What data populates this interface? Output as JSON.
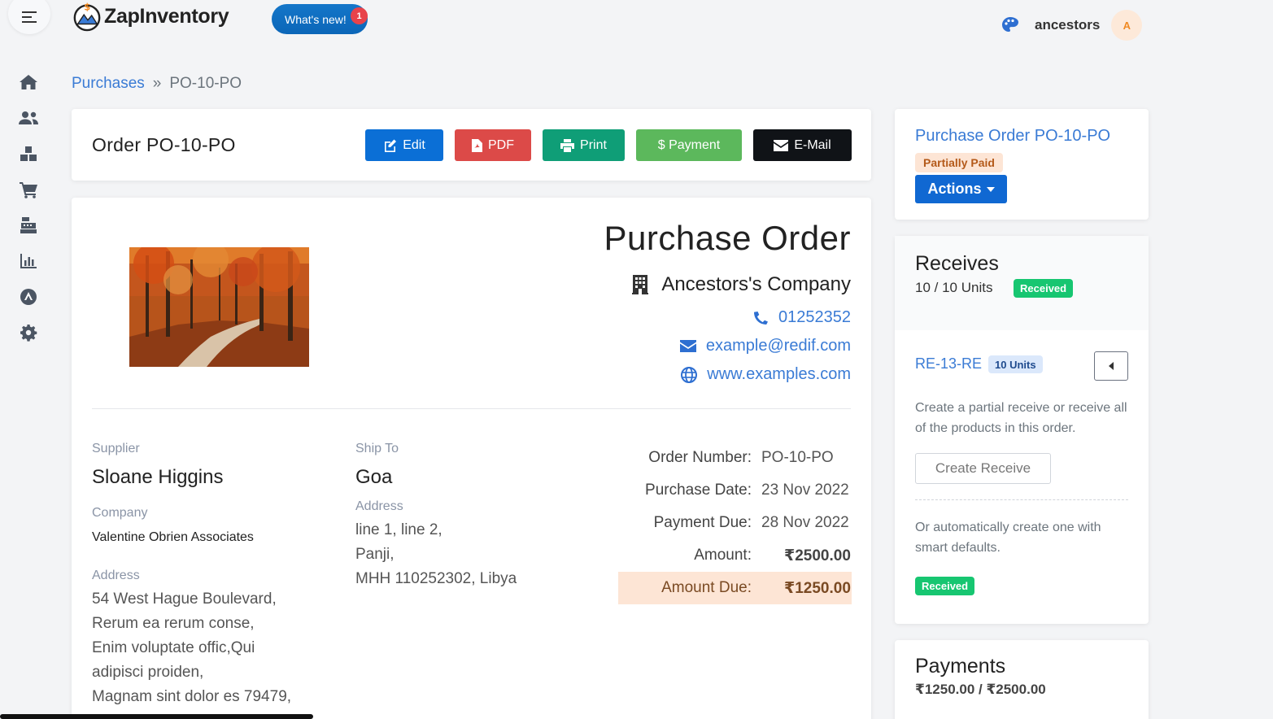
{
  "app": {
    "name": "ZapInventory",
    "whats_new": "What's new!",
    "whats_new_count": "1",
    "username": "ancestors",
    "avatar_initial": "A"
  },
  "sidebar": {
    "icons": [
      "home-icon",
      "users-icon",
      "boxes-icon",
      "cart-icon",
      "cash-register-icon",
      "chart-icon",
      "app-store-icon",
      "gear-icon"
    ]
  },
  "breadcrumb": {
    "parent": "Purchases",
    "separator": "»",
    "current": "PO-10-PO"
  },
  "header": {
    "title": "Order PO-10-PO",
    "buttons": {
      "edit": "Edit",
      "pdf": "PDF",
      "print": "Print",
      "payment": "$ Payment",
      "email": "E-Mail"
    },
    "colors": {
      "edit": "#0b6fd6",
      "pdf": "#dc4a48",
      "print": "#0f9e77",
      "payment": "#5cb85c",
      "email": "#101317"
    }
  },
  "document": {
    "heading": "Purchase Order",
    "company": "Ancestors's Company",
    "phone": "01252352",
    "email": "example@redif.com",
    "website": "www.examples.com",
    "supplier": {
      "label": "Supplier",
      "name": "Sloane Higgins",
      "company_label": "Company",
      "company": "Valentine Obrien Associates",
      "address_label": "Address",
      "address_lines": [
        "54 West Hague Boulevard,",
        "Rerum ea rerum conse,",
        "Enim voluptate offic,Qui",
        "adipisci proiden,",
        "Magnam sint dolor es 79479,"
      ]
    },
    "ship_to": {
      "label": "Ship To",
      "name": "Goa",
      "address_label": "Address",
      "address_lines": [
        "line 1, line 2,",
        "Panji,",
        "MHH 110252302, Libya"
      ]
    },
    "meta": {
      "order_number_label": "Order Number:",
      "order_number": "PO-10-PO",
      "purchase_date_label": "Purchase Date:",
      "purchase_date": "23 Nov 2022",
      "payment_due_label": "Payment Due:",
      "payment_due": "28 Nov 2022",
      "amount_label": "Amount:",
      "amount": "₹2500.00",
      "amount_due_label": "Amount Due:",
      "amount_due": "₹1250.00"
    }
  },
  "summary": {
    "title": "Purchase Order PO-10-PO",
    "status": "Partially Paid",
    "actions": "Actions"
  },
  "receives": {
    "title": "Receives",
    "units": "10 / 10 Units",
    "status": "Received",
    "item_ref": "RE-13-RE",
    "item_units": "10 Units",
    "help_text": "Create a partial receive or receive all of the products in this order.",
    "create_button": "Create Receive",
    "auto_text": "Or automatically create one with smart defaults.",
    "auto_status": "Received"
  },
  "payments": {
    "title": "Payments",
    "totals": "₹1250.00 / ₹2500.00"
  }
}
